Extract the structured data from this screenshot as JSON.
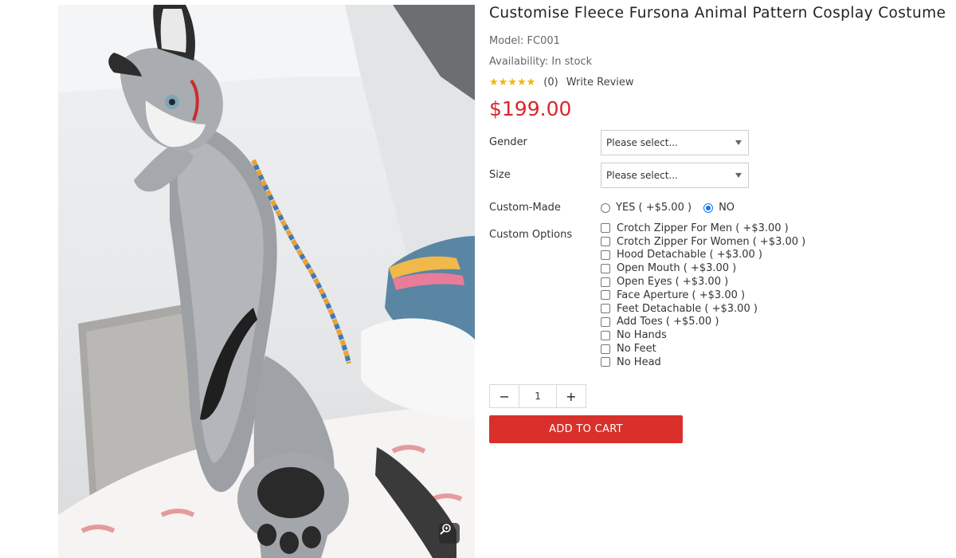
{
  "product": {
    "title": "Customise Fleece Fursona Animal Pattern Cosplay Costume",
    "model": "Model: FC001",
    "availability": "Availability: In stock",
    "stars": "★★★★★",
    "rating_value": 0,
    "review_count": "(0)",
    "write_review": "Write Review",
    "price": "$199.00"
  },
  "image": {
    "alt_icon": "person-in-fursuit-photo",
    "zoom_icon": "zoom-in-icon"
  },
  "form": {
    "gender": {
      "label": "Gender",
      "value": "Please select..."
    },
    "size": {
      "label": "Size",
      "value": "Please select..."
    },
    "custom_made": {
      "label": "Custom-Made",
      "options": [
        {
          "label": "YES ( +$5.00 )",
          "checked": false
        },
        {
          "label": "NO",
          "checked": true
        }
      ]
    },
    "custom_options": {
      "label": "Custom Options",
      "items": [
        "Crotch Zipper For Men ( +$3.00 )",
        "Crotch Zipper For Women ( +$3.00 )",
        "Hood Detachable ( +$3.00 )",
        "Open Mouth ( +$3.00 )",
        "Open Eyes ( +$3.00 )",
        "Face Aperture ( +$3.00 )",
        "Feet Detachable ( +$3.00 )",
        "Add Toes ( +$5.00 )",
        "No Hands",
        "No Feet",
        "No Head"
      ]
    },
    "quantity": {
      "minus": "−",
      "value": "1",
      "plus": "+"
    },
    "add_to_cart": "ADD TO CART"
  },
  "colors": {
    "price": "#d8262c",
    "button": "#d9302c",
    "radio_accent": "#1a73e8",
    "stars": "#f5b301"
  }
}
